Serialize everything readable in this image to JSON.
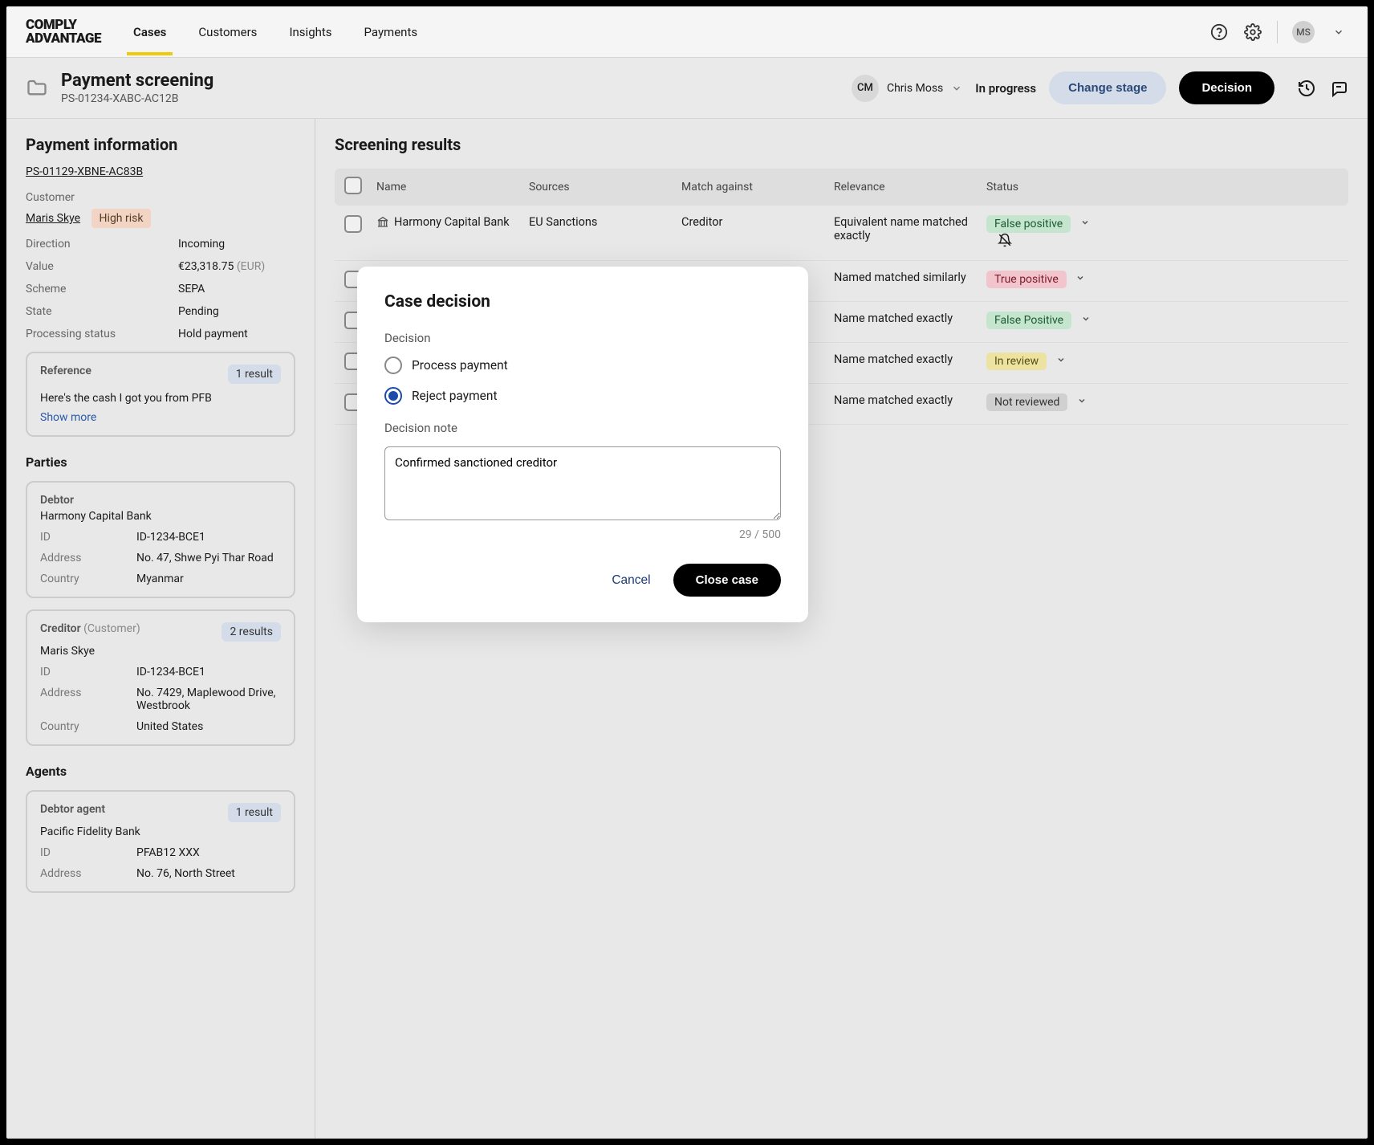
{
  "brand": "COMPLY\nADVANTAGE",
  "nav": {
    "tabs": [
      "Cases",
      "Customers",
      "Insights",
      "Payments"
    ],
    "active": 0,
    "user_initials": "MS"
  },
  "header": {
    "title": "Payment screening",
    "case_id": "PS-01234-XABC-AC12B",
    "assignee_initials": "CM",
    "assignee_name": "Chris Moss",
    "status": "In progress",
    "change_stage": "Change stage",
    "decision": "Decision"
  },
  "sidebar": {
    "title": "Payment information",
    "payment_ref": "PS-01129-XBNE-AC83B",
    "customer_label": "Customer",
    "customer_name": "Maris Skye",
    "risk_badge": "High risk",
    "fields": [
      {
        "k": "Direction",
        "v": "Incoming"
      },
      {
        "k": "Value",
        "v": "€23,318.75",
        "suffix": " (EUR)"
      },
      {
        "k": "Scheme",
        "v": "SEPA"
      },
      {
        "k": "State",
        "v": "Pending"
      },
      {
        "k": "Processing status",
        "v": "Hold payment"
      }
    ],
    "reference": {
      "label": "Reference",
      "count": "1 result",
      "text": "Here's the cash I got you from PFB",
      "show_more": "Show more"
    },
    "parties_label": "Parties",
    "debtor": {
      "role": "Debtor",
      "name": "Harmony Capital Bank",
      "fields": [
        {
          "k": "ID",
          "v": "ID-1234-BCE1"
        },
        {
          "k": "Address",
          "v": "No. 47, Shwe Pyi Thar Road"
        },
        {
          "k": "Country",
          "v": "Myanmar"
        }
      ]
    },
    "creditor": {
      "role": "Creditor",
      "role_suffix": "(Customer)",
      "count": "2 results",
      "name": "Maris Skye",
      "fields": [
        {
          "k": "ID",
          "v": "ID-1234-BCE1"
        },
        {
          "k": "Address",
          "v": "No. 7429, Maplewood Drive, Westbrook"
        },
        {
          "k": "Country",
          "v": "United States"
        }
      ]
    },
    "agents_label": "Agents",
    "debtor_agent": {
      "role": "Debtor agent",
      "count": "1 result",
      "name": "Pacific Fidelity Bank",
      "fields": [
        {
          "k": "ID",
          "v": "PFAB12 XXX"
        },
        {
          "k": "Address",
          "v": "No. 76, North Street"
        }
      ]
    }
  },
  "main": {
    "title": "Screening results",
    "columns": [
      "Name",
      "Sources",
      "Match against",
      "Relevance",
      "Status"
    ],
    "rows": [
      {
        "name": "Harmony Capital Bank",
        "src": "EU Sanctions",
        "match": "Creditor",
        "rel": "Equivalent name matched exactly",
        "status": "False positive",
        "status_class": "pill-green",
        "bell_off": true
      },
      {
        "name": "",
        "src": "",
        "match": "",
        "rel": "Named matched similarly",
        "status": "True positive",
        "status_class": "pill-red"
      },
      {
        "name": "",
        "src": "",
        "match": "",
        "rel": "Name matched exactly",
        "status": "False Positive",
        "status_class": "pill-green"
      },
      {
        "name": "",
        "src": "",
        "match": "",
        "rel": "Name matched exactly",
        "status": "In review",
        "status_class": "pill-yellow"
      },
      {
        "name": "",
        "src": "",
        "match": "",
        "rel": "Name matched exactly",
        "status": "Not reviewed",
        "status_class": "pill-grey"
      }
    ]
  },
  "modal": {
    "title": "Case decision",
    "decision_label": "Decision",
    "options": [
      "Process payment",
      "Reject payment"
    ],
    "selected": 1,
    "note_label": "Decision note",
    "note_value": "Confirmed sanctioned creditor",
    "char_count": "29 / 500",
    "cancel": "Cancel",
    "close": "Close case"
  }
}
